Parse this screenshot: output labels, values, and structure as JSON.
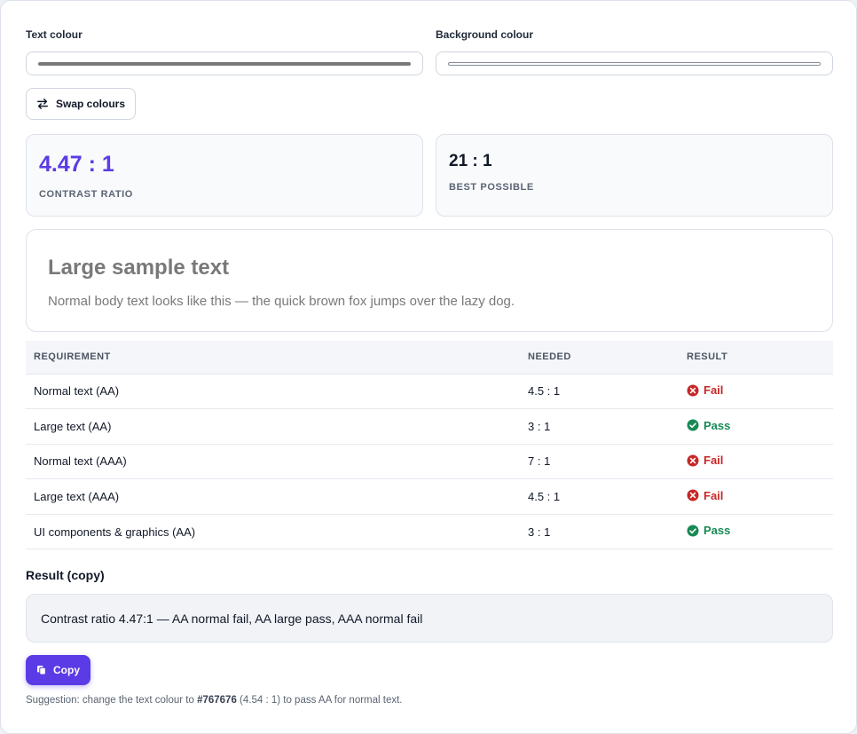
{
  "inputs": {
    "text_colour_label": "Text colour",
    "background_colour_label": "Background colour",
    "text_colour_value": "#797979",
    "background_colour_value": "#FFFFFF"
  },
  "swap_button": {
    "label": "Swap colours",
    "icon": "swap-arrows-icon"
  },
  "stats": {
    "contrast_value": "4.47 : 1",
    "contrast_caption": "CONTRAST RATIO",
    "best_value": "21 : 1",
    "best_caption": "BEST POSSIBLE"
  },
  "sample": {
    "large_text": "Large sample text",
    "body_text": "Normal body text looks like this — the quick brown fox jumps over the lazy dog."
  },
  "table": {
    "headers": [
      "REQUIREMENT",
      "NEEDED",
      "RESULT"
    ],
    "rows": [
      {
        "requirement": "Normal text (AA)",
        "needed": "4.5 : 1",
        "result": "Fail"
      },
      {
        "requirement": "Large text (AA)",
        "needed": "3 : 1",
        "result": "Pass"
      },
      {
        "requirement": "Normal text (AAA)",
        "needed": "7 : 1",
        "result": "Fail"
      },
      {
        "requirement": "Large text (AAA)",
        "needed": "4.5 : 1",
        "result": "Fail"
      },
      {
        "requirement": "UI components & graphics (AA)",
        "needed": "3 : 1",
        "result": "Pass"
      }
    ]
  },
  "result_copy": {
    "heading": "Result (copy)",
    "text": "Contrast ratio 4.47:1 — AA normal fail, AA large pass, AAA normal fail",
    "copy_button": "Copy"
  },
  "suggestion": {
    "prefix": "Suggestion: change the text colour to ",
    "colour": "#767676",
    "suffix": " (4.54 : 1) to pass AA for normal text."
  },
  "colors": {
    "accent": "#5B3BE6",
    "contrast_value": "#5B3BE6",
    "fail": "#C62828",
    "pass": "#168A55"
  }
}
